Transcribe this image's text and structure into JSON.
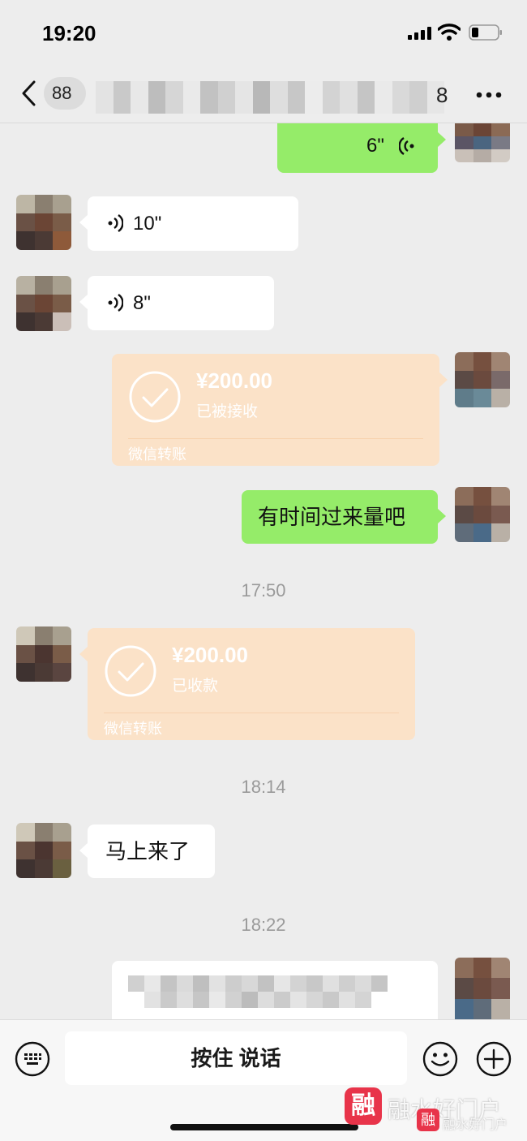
{
  "status_bar": {
    "time": "19:20"
  },
  "header": {
    "badge": "88",
    "title_end": "8"
  },
  "messages": {
    "m1": {
      "duration": "6\""
    },
    "m2": {
      "duration": "10\""
    },
    "m3": {
      "duration": "8\""
    },
    "m4": {
      "amount": "¥200.00",
      "status": "已被接收",
      "footer": "微信转账"
    },
    "m5": {
      "text": "有时间过来量吧"
    },
    "ts1": "17:50",
    "m6": {
      "amount": "¥200.00",
      "status": "已收款",
      "footer": "微信转账"
    },
    "ts2": "18:14",
    "m7": {
      "text": "马上来了"
    },
    "ts3": "18:22"
  },
  "input_bar": {
    "talk_label": "按住 说话"
  },
  "watermark": {
    "logo": "融",
    "text": "融水好门户"
  },
  "colors": {
    "outgoing_bubble": "#95ec69",
    "incoming_bubble": "#ffffff",
    "transfer_card": "#fbe2c8",
    "background": "#ededed"
  }
}
